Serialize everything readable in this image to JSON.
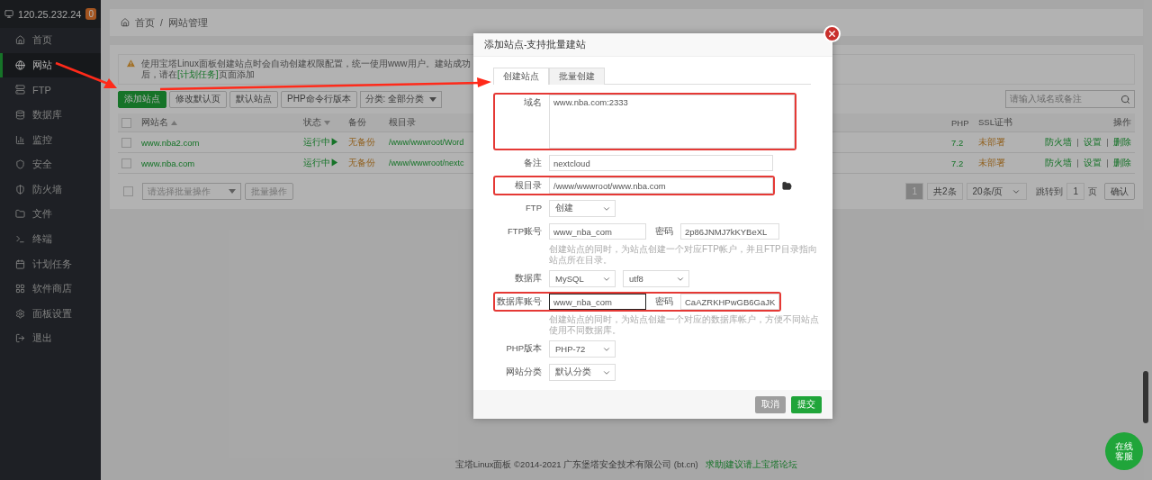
{
  "sidebar": {
    "host": "120.25.232.24",
    "badge": "0",
    "items": [
      {
        "label": "首页",
        "selected": false
      },
      {
        "label": "网站",
        "selected": true
      },
      {
        "label": "FTP",
        "selected": false
      },
      {
        "label": "数据库",
        "selected": false
      },
      {
        "label": "监控",
        "selected": false
      },
      {
        "label": "安全",
        "selected": false
      },
      {
        "label": "防火墙",
        "selected": false
      },
      {
        "label": "文件",
        "selected": false
      },
      {
        "label": "终端",
        "selected": false
      },
      {
        "label": "计划任务",
        "selected": false
      },
      {
        "label": "软件商店",
        "selected": false
      },
      {
        "label": "面板设置",
        "selected": false
      },
      {
        "label": "退出",
        "selected": false
      }
    ]
  },
  "breadcrumb": {
    "items": [
      "首页",
      "网站管理"
    ],
    "separator": "/"
  },
  "notice": {
    "text": "使用宝塔Linux面板创建站点时会自动创建权限配置，统一使用www用户。建站成功后，请在",
    "link": "[计划任务]",
    "text_after": "页面添加"
  },
  "toolbar": {
    "buttons": [
      {
        "label": "添加站点",
        "primary": true
      },
      {
        "label": "修改默认页",
        "primary": false
      },
      {
        "label": "默认站点",
        "primary": false
      },
      {
        "label": "PHP命令行版本",
        "primary": false
      }
    ],
    "category": "分类: 全部分类",
    "search_placeholder": "请输入域名或备注"
  },
  "table": {
    "header_checked": false,
    "columns": [
      {
        "label": "网站名",
        "sort_ascending": true
      },
      {
        "label": "状态",
        "sort_ascending": false
      },
      {
        "label": "备份"
      },
      {
        "label": "根目录"
      },
      {
        "label": "PHP"
      },
      {
        "label": "SSL证书"
      },
      {
        "label": "操作"
      }
    ],
    "rows": [
      {
        "checked": false,
        "name": "www.nba2.com",
        "status": "运行中▶",
        "backup": "无备份",
        "root": "/www/wwwroot/Word",
        "php": "7.2",
        "ssl": "未部署",
        "actions": [
          "防火墙",
          "设置",
          "删除"
        ]
      },
      {
        "checked": false,
        "name": "www.nba.com",
        "status": "运行中▶",
        "backup": "无备份",
        "root": "/www/wwwroot/nextc",
        "php": "7.2",
        "ssl": "未部署",
        "actions": [
          "防火墙",
          "设置",
          "删除"
        ]
      }
    ]
  },
  "batch": {
    "checked": false,
    "placeholder": "请选择批量操作",
    "button": "批量操作"
  },
  "pagination": {
    "pages": [
      {
        "label": "1",
        "selected": true
      }
    ],
    "total": "共2条",
    "per_page": "20条/页",
    "goto_label": "跳转到",
    "goto_value": "1",
    "page_unit": "页",
    "confirm": "确认"
  },
  "footer": {
    "copyright": "宝塔Linux面板 ©2014-2021 广东堡塔安全技术有限公司 (bt.cn)",
    "link": "求助|建议请上宝塔论坛"
  },
  "chat": "在线客服",
  "modal": {
    "title": "添加站点-支持批量建站",
    "tabs": [
      {
        "label": "创建站点",
        "selected": true
      },
      {
        "label": "批量创建",
        "selected": false
      }
    ],
    "fields": [
      {
        "kind": "textarea",
        "label": "域名",
        "value": "www.nba.com:2333",
        "highlighted": true
      },
      {
        "kind": "input",
        "label": "备注",
        "value": "nextcloud",
        "highlighted": false
      },
      {
        "kind": "path",
        "label": "根目录",
        "value": "/www/wwwroot/www.nba.com",
        "highlighted": true
      },
      {
        "kind": "select",
        "label": "FTP",
        "value": "创建",
        "highlighted": false
      },
      {
        "kind": "pair",
        "label": "FTP账号",
        "value": "www_nba_com",
        "label2": "密码",
        "value2": "2p86JNMJ7kKYBeXL",
        "focused": false,
        "highlighted": false
      },
      {
        "kind": "hint",
        "text": "创建站点的同时，为站点创建一个对应FTP帐户，并且FTP目录指向站点所在目录。"
      },
      {
        "kind": "select2",
        "label": "数据库",
        "value": "MySQL",
        "value2": "utf8",
        "highlighted": false
      },
      {
        "kind": "pair",
        "label": "数据库账号",
        "value": "www_nba_com",
        "label2": "密码",
        "value2": "CaAZRKHPwGB6GaJK",
        "focused": true,
        "highlighted": true
      },
      {
        "kind": "hint",
        "text": "创建站点的同时，为站点创建一个对应的数据库帐户，方便不同站点使用不同数据库。"
      },
      {
        "kind": "select",
        "label": "PHP版本",
        "value": "PHP-72",
        "highlighted": false
      },
      {
        "kind": "select",
        "label": "网站分类",
        "value": "默认分类",
        "highlighted": false
      }
    ],
    "buttons": [
      {
        "label": "取消",
        "disabled": true
      },
      {
        "label": "提交",
        "disabled": false
      }
    ]
  }
}
